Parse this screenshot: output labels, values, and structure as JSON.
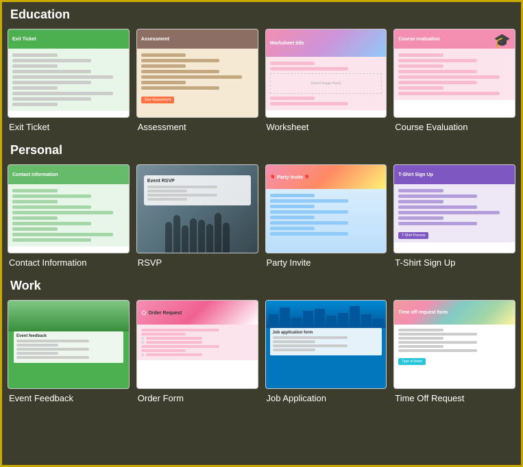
{
  "sections": [
    {
      "id": "education",
      "label": "Education",
      "items": [
        {
          "id": "exit-ticket",
          "label": "Exit Ticket",
          "thumb": "exit-ticket"
        },
        {
          "id": "assessment",
          "label": "Assessment",
          "thumb": "assessment"
        },
        {
          "id": "worksheet",
          "label": "Worksheet",
          "thumb": "worksheet"
        },
        {
          "id": "course-evaluation",
          "label": "Course Evaluation",
          "thumb": "course-eval"
        }
      ]
    },
    {
      "id": "personal",
      "label": "Personal",
      "items": [
        {
          "id": "contact-information",
          "label": "Contact Information",
          "thumb": "contact"
        },
        {
          "id": "rsvp",
          "label": "RSVP",
          "thumb": "rsvp"
        },
        {
          "id": "party-invite",
          "label": "Party Invite",
          "thumb": "party"
        },
        {
          "id": "tshirt-signup",
          "label": "T-Shirt Sign Up",
          "thumb": "tshirt"
        }
      ]
    },
    {
      "id": "work",
      "label": "Work",
      "items": [
        {
          "id": "event-feedback",
          "label": "Event Feedback",
          "thumb": "event-feedback"
        },
        {
          "id": "order-form",
          "label": "Order Form",
          "thumb": "order-form"
        },
        {
          "id": "job-application",
          "label": "Job Application",
          "thumb": "job-app"
        },
        {
          "id": "time-off-request",
          "label": "Time Off Request",
          "thumb": "time-off"
        }
      ]
    }
  ]
}
